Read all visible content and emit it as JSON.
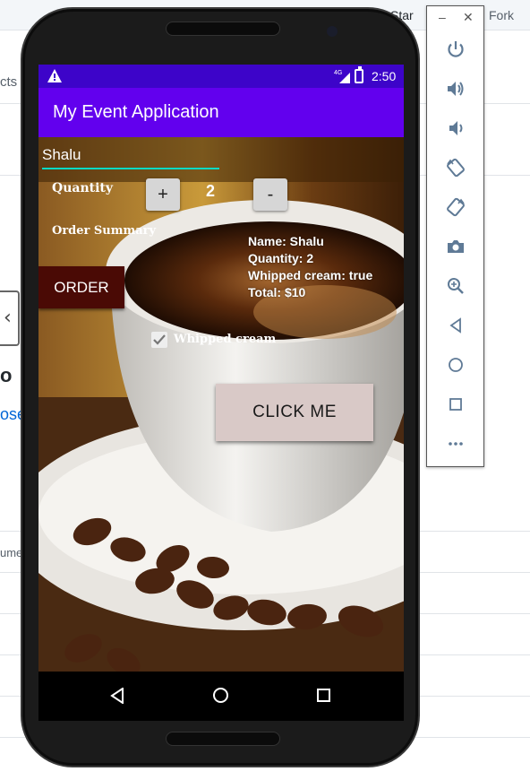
{
  "background_page": {
    "star_label": "Star",
    "fork_label": "Fork",
    "tab_fragment": "cts",
    "tab_fragment_right": "t",
    "heading_fragment": "o",
    "link_fragment": "ose",
    "column_fragment": "ume"
  },
  "status_bar": {
    "network": "4G",
    "time": "2:50"
  },
  "app_bar": {
    "title": "My Event Application"
  },
  "form": {
    "name_value": "Shalu",
    "quantity_label": "Quantity",
    "plus_label": "+",
    "quantity_value": "2",
    "minus_label": "-",
    "order_summary_label": "Order Summary",
    "summary_lines": [
      "Name: Shalu",
      "Quantity: 2",
      "Whipped cream: true",
      "Total: $10"
    ],
    "order_button_label": "ORDER",
    "whipped_cream_label": "Whipped cream",
    "whipped_cream_checked": true,
    "click_me_label": "CLICK ME"
  },
  "colors": {
    "status_bar": "#3d04c9",
    "app_bar": "#6200ee",
    "input_underline": "#03dac5",
    "order_button": "#4a0a05",
    "click_me_button": "#d9c9c7"
  },
  "nav_bar": {
    "icons": [
      "back-icon",
      "home-icon",
      "recents-icon"
    ]
  },
  "emulator_toolbar": {
    "window_controls": [
      "minimize-icon",
      "close-icon"
    ],
    "tools": [
      "power-icon",
      "volume-up-icon",
      "volume-down-icon",
      "rotate-left-icon",
      "rotate-right-icon",
      "camera-icon",
      "zoom-icon",
      "back-icon",
      "home-icon",
      "overview-icon",
      "more-icon"
    ]
  }
}
